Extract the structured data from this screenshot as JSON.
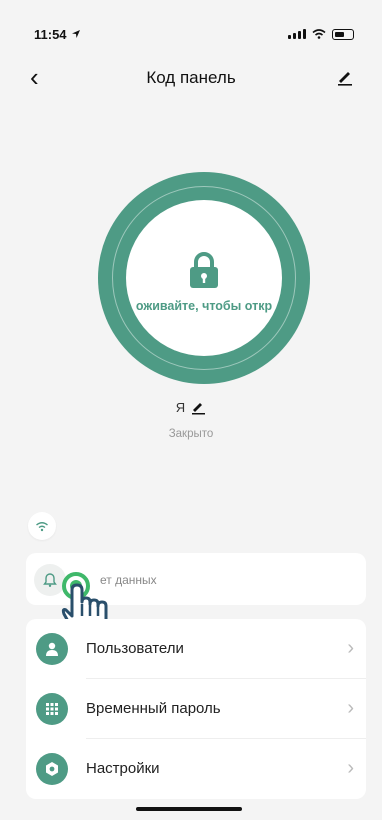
{
  "status_bar": {
    "time": "11:54"
  },
  "header": {
    "title": "Код панель"
  },
  "lock": {
    "hint": "оживайте, чтобы откр"
  },
  "user": {
    "name": "Я",
    "state": "Закрыто"
  },
  "events": {
    "text": "ет данных"
  },
  "menu": [
    {
      "label": "Пользователи",
      "icon": "user-icon"
    },
    {
      "label": "Временный пароль",
      "icon": "keypad-icon"
    },
    {
      "label": "Настройки",
      "icon": "settings-icon"
    }
  ],
  "colors": {
    "accent": "#4e9b85",
    "background": "#f4f4f4"
  }
}
